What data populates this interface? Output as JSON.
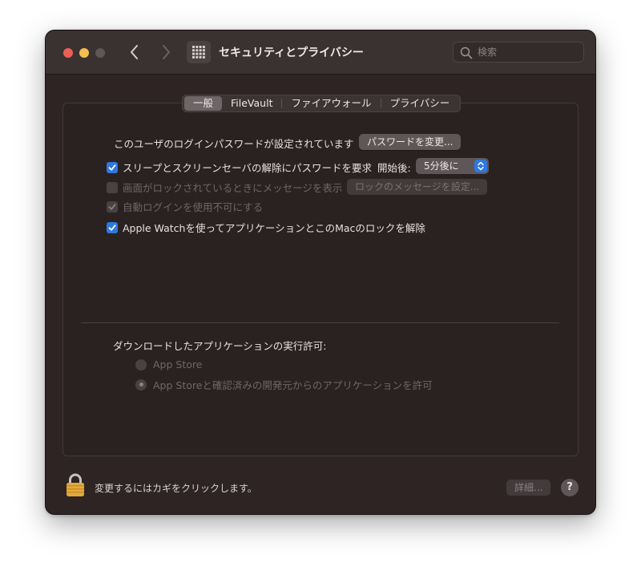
{
  "window": {
    "title": "セキュリティとプライバシー",
    "search_placeholder": "検索"
  },
  "tabs": [
    {
      "label": "一般",
      "active": true
    },
    {
      "label": "FileVault",
      "active": false
    },
    {
      "label": "ファイアウォール",
      "active": false
    },
    {
      "label": "プライバシー",
      "active": false
    }
  ],
  "general": {
    "password_text": "このユーザのログインパスワードが設定されています",
    "change_password_button": "パスワードを変更...",
    "require_password_label": "スリープとスクリーンセーバの解除にパスワードを要求",
    "require_password_checked": true,
    "delay_label": "開始後:",
    "delay_value": "5分後に",
    "show_message_label": "画面がロックされているときにメッセージを表示",
    "show_message_checked": false,
    "set_lock_message_button": "ロックのメッセージを設定...",
    "disable_autologin_label": "自動ログインを使用不可にする",
    "disable_autologin_checked": true,
    "apple_watch_label": "Apple Watchを使ってアプリケーションとこのMacのロックを解除",
    "apple_watch_checked": true
  },
  "downloads": {
    "heading": "ダウンロードしたアプリケーションの実行許可:",
    "options": [
      {
        "label": "App Store",
        "selected": false
      },
      {
        "label": "App Storeと確認済みの開発元からのアプリケーションを許可",
        "selected": true
      }
    ]
  },
  "footer": {
    "lock_text": "変更するにはカギをクリックします。",
    "advanced_button": "詳細...",
    "help_label": "?"
  },
  "icons": {
    "close": "close-icon",
    "minimize": "minimize-icon",
    "back": "chevron-left-icon",
    "forward": "chevron-right-icon",
    "grid": "grid-icon",
    "search": "search-icon",
    "lock": "lock-icon",
    "checkmark": "checkmark-icon"
  },
  "colors": {
    "accent": "#2f78e0",
    "close": "#ec5f57",
    "minimize": "#f4bf4f",
    "window_bg": "#2e2424"
  }
}
